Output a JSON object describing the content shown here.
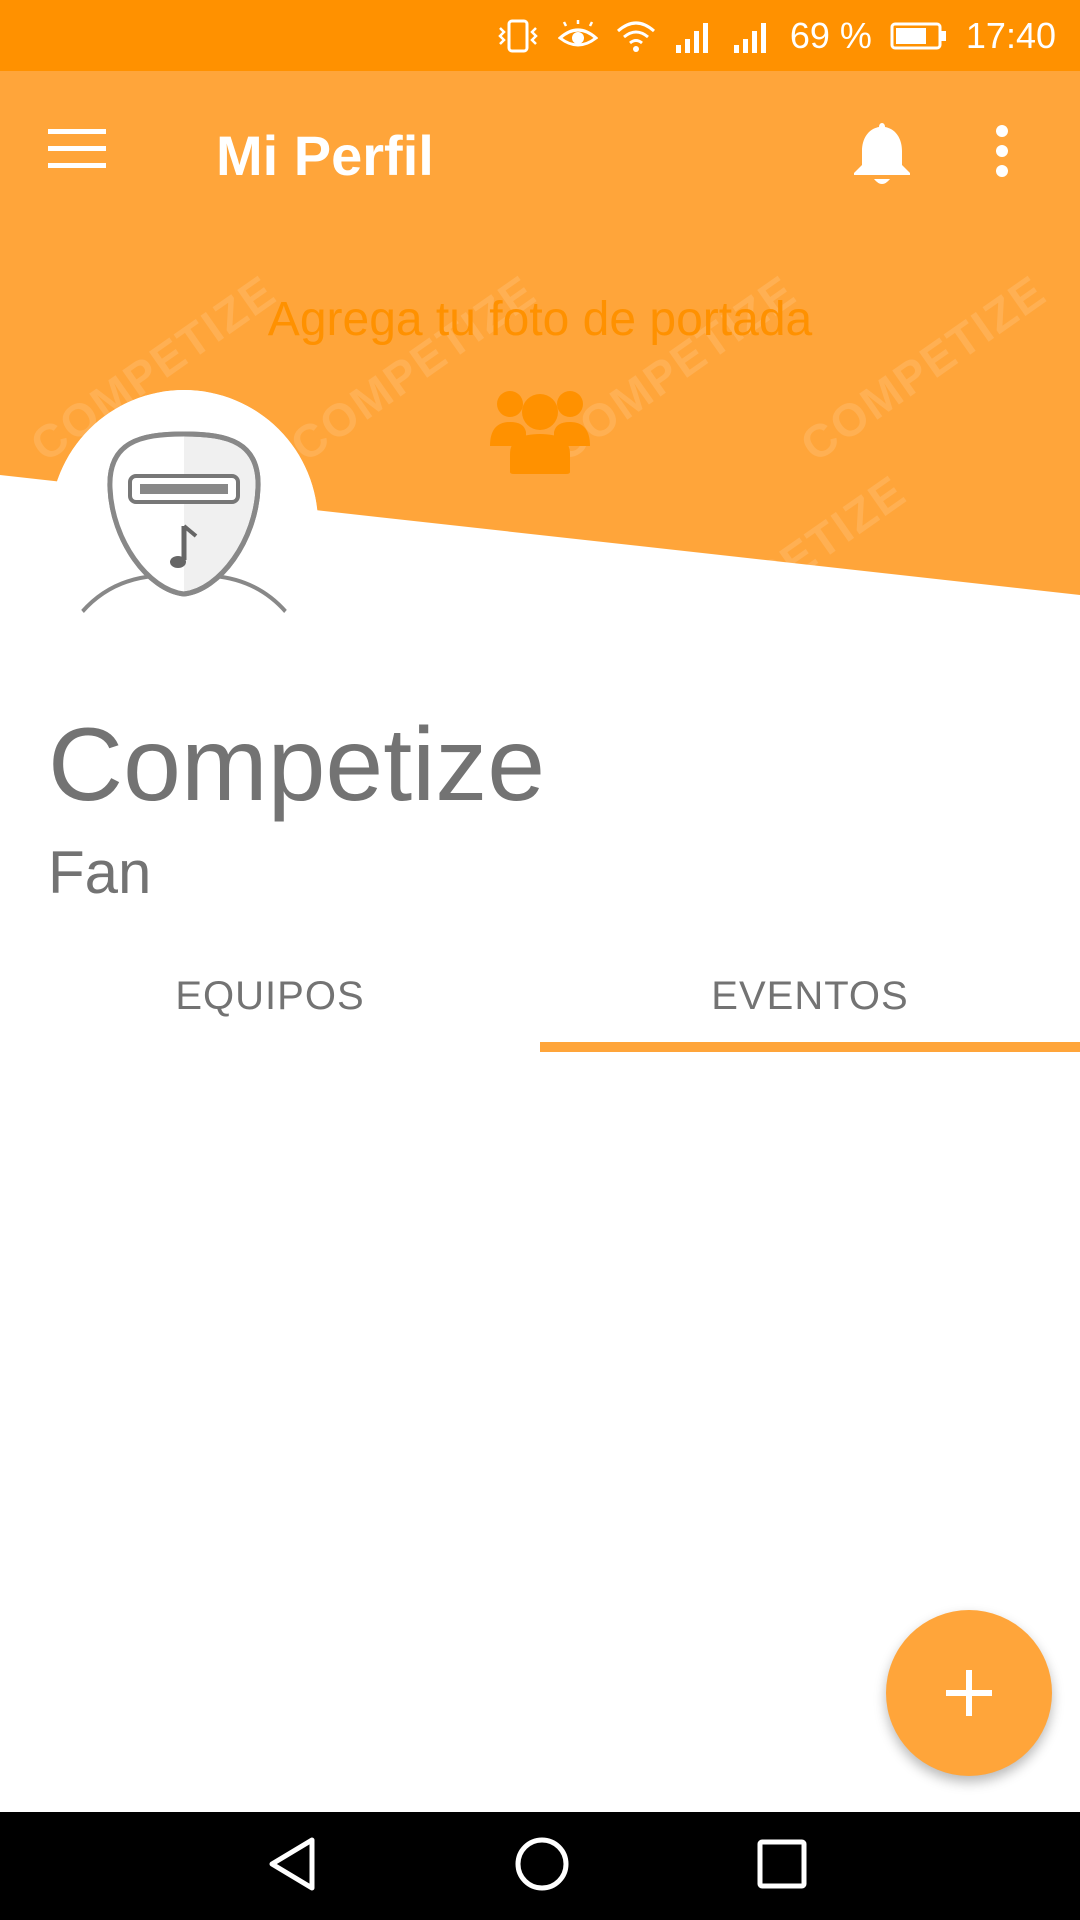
{
  "status_bar": {
    "battery_percent": "69 %",
    "time": "17:40",
    "icons": [
      "vibrate-icon",
      "eye-icon",
      "wifi-icon",
      "signal-icon",
      "signal-icon",
      "battery-icon"
    ]
  },
  "app_bar": {
    "title": "Mi Perfil",
    "menu_icon": "hamburger-menu-icon",
    "bell_icon": "bell-icon",
    "more_icon": "more-vertical-icon"
  },
  "cover": {
    "prompt": "Agrega tu foto de portada",
    "icon": "group-icon",
    "watermark": "COMPETIZE"
  },
  "profile": {
    "name": "Competize",
    "role": "Fan"
  },
  "tabs": [
    {
      "label": "EQUIPOS",
      "selected": false
    },
    {
      "label": "EVENTOS",
      "selected": true
    }
  ],
  "fab": {
    "icon": "plus-icon"
  },
  "nav_bar": {
    "icons": [
      "back-icon",
      "home-icon",
      "recents-icon"
    ]
  },
  "colors": {
    "status_bar": "#FF9100",
    "header": "#FFA53A",
    "accent_text": "#FF9100",
    "text_gray": "#737373"
  }
}
